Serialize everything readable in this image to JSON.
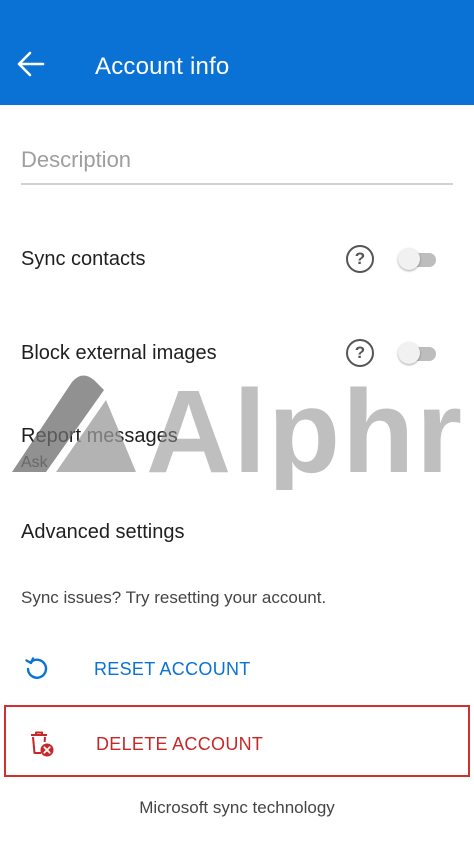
{
  "header": {
    "title": "Account info",
    "bg_color": "#0a72d4"
  },
  "description": {
    "placeholder": "Description",
    "value": ""
  },
  "settings": {
    "sync_contacts": {
      "label": "Sync contacts",
      "enabled": false,
      "help_glyph": "?"
    },
    "block_images": {
      "label": "Block external images",
      "enabled": false,
      "help_glyph": "?"
    },
    "report_messages": {
      "label": "Report messages",
      "value": "Ask"
    },
    "advanced": {
      "label": "Advanced settings"
    }
  },
  "hint": "Sync issues? Try resetting your account.",
  "actions": {
    "reset": {
      "label": "RESET ACCOUNT",
      "icon": "refresh-icon",
      "color": "#0a72d4"
    },
    "delete": {
      "label": "DELETE ACCOUNT",
      "icon": "trash-icon",
      "color": "#c62828"
    }
  },
  "footer": "Microsoft sync technology",
  "watermark": {
    "text": "Alphr"
  }
}
